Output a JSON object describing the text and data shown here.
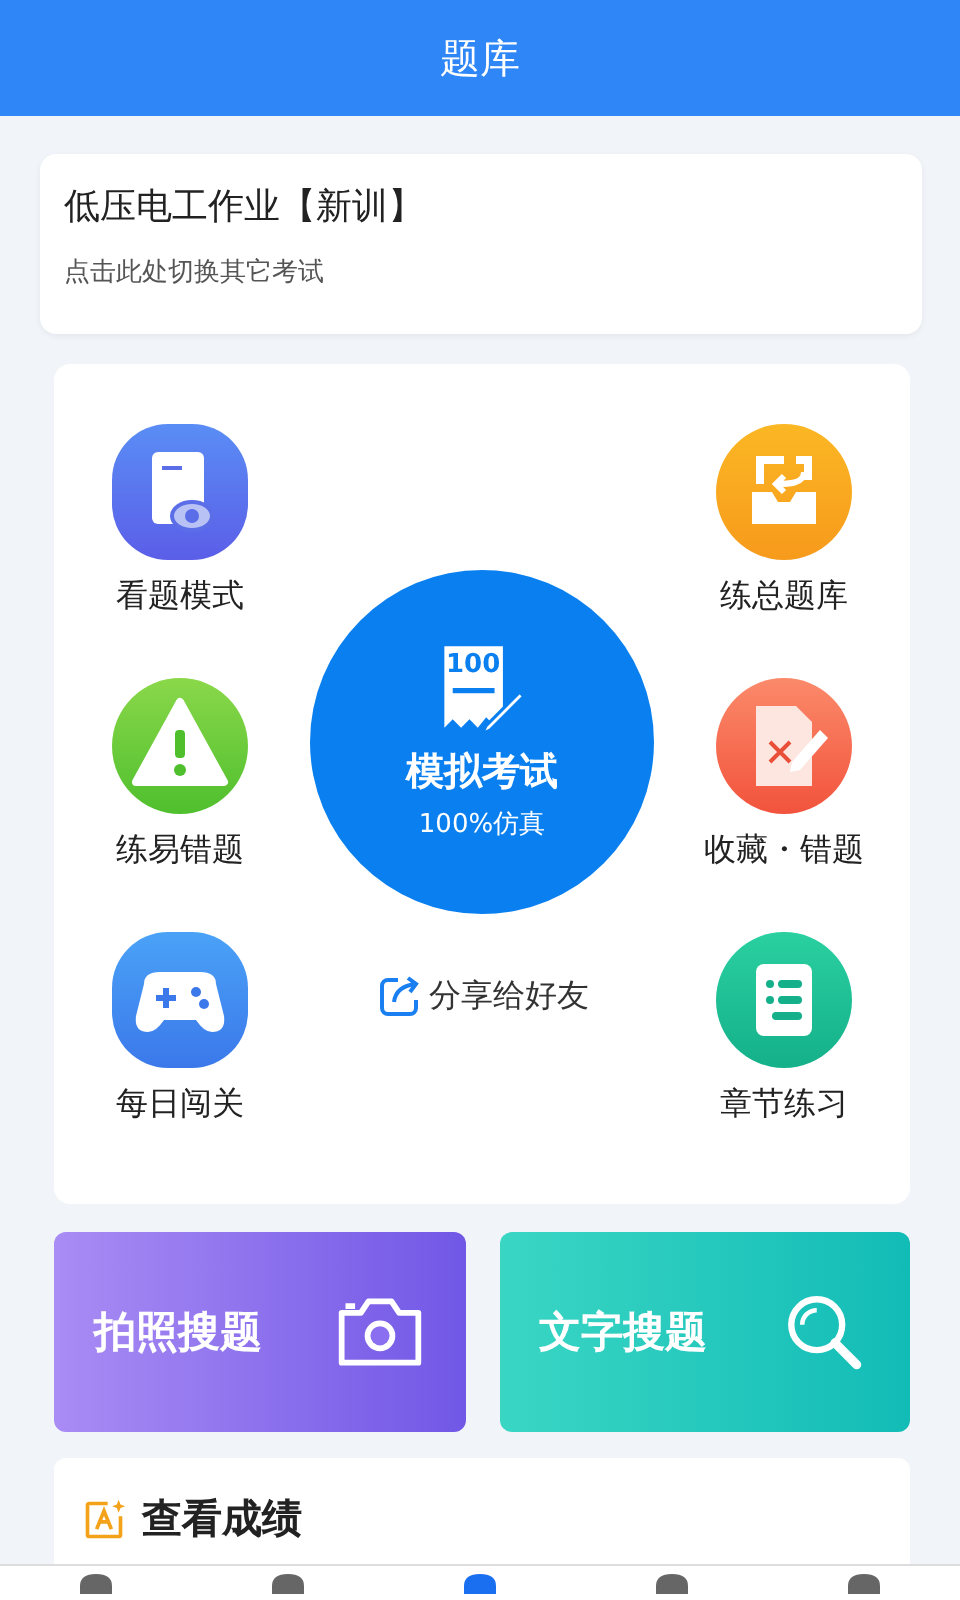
{
  "header": {
    "title": "题库"
  },
  "exam_selector": {
    "title": "低压电工作业【新训】",
    "subtitle": "点击此处切换其它考试"
  },
  "modes": [
    {
      "label": "看题模式",
      "kind": "view"
    },
    {
      "label": "练总题库",
      "kind": "all"
    },
    {
      "label": "练易错题",
      "kind": "mistake"
    },
    {
      "label": "收藏・错题",
      "kind": "favorite"
    },
    {
      "label": "每日闯关",
      "kind": "game"
    },
    {
      "label": "章节练习",
      "kind": "chapter"
    }
  ],
  "mock_exam": {
    "icon_text": "100",
    "title": "模拟考试",
    "subtitle": "100%仿真"
  },
  "share": {
    "label": "分享给好友"
  },
  "search_buttons": [
    {
      "label": "拍照搜题",
      "kind": "photo"
    },
    {
      "label": "文字搜题",
      "kind": "text"
    }
  ],
  "results": {
    "title": "查看成绩"
  },
  "nav": [
    {
      "selected": false
    },
    {
      "selected": false
    },
    {
      "selected": true
    },
    {
      "selected": false
    },
    {
      "selected": false
    }
  ]
}
